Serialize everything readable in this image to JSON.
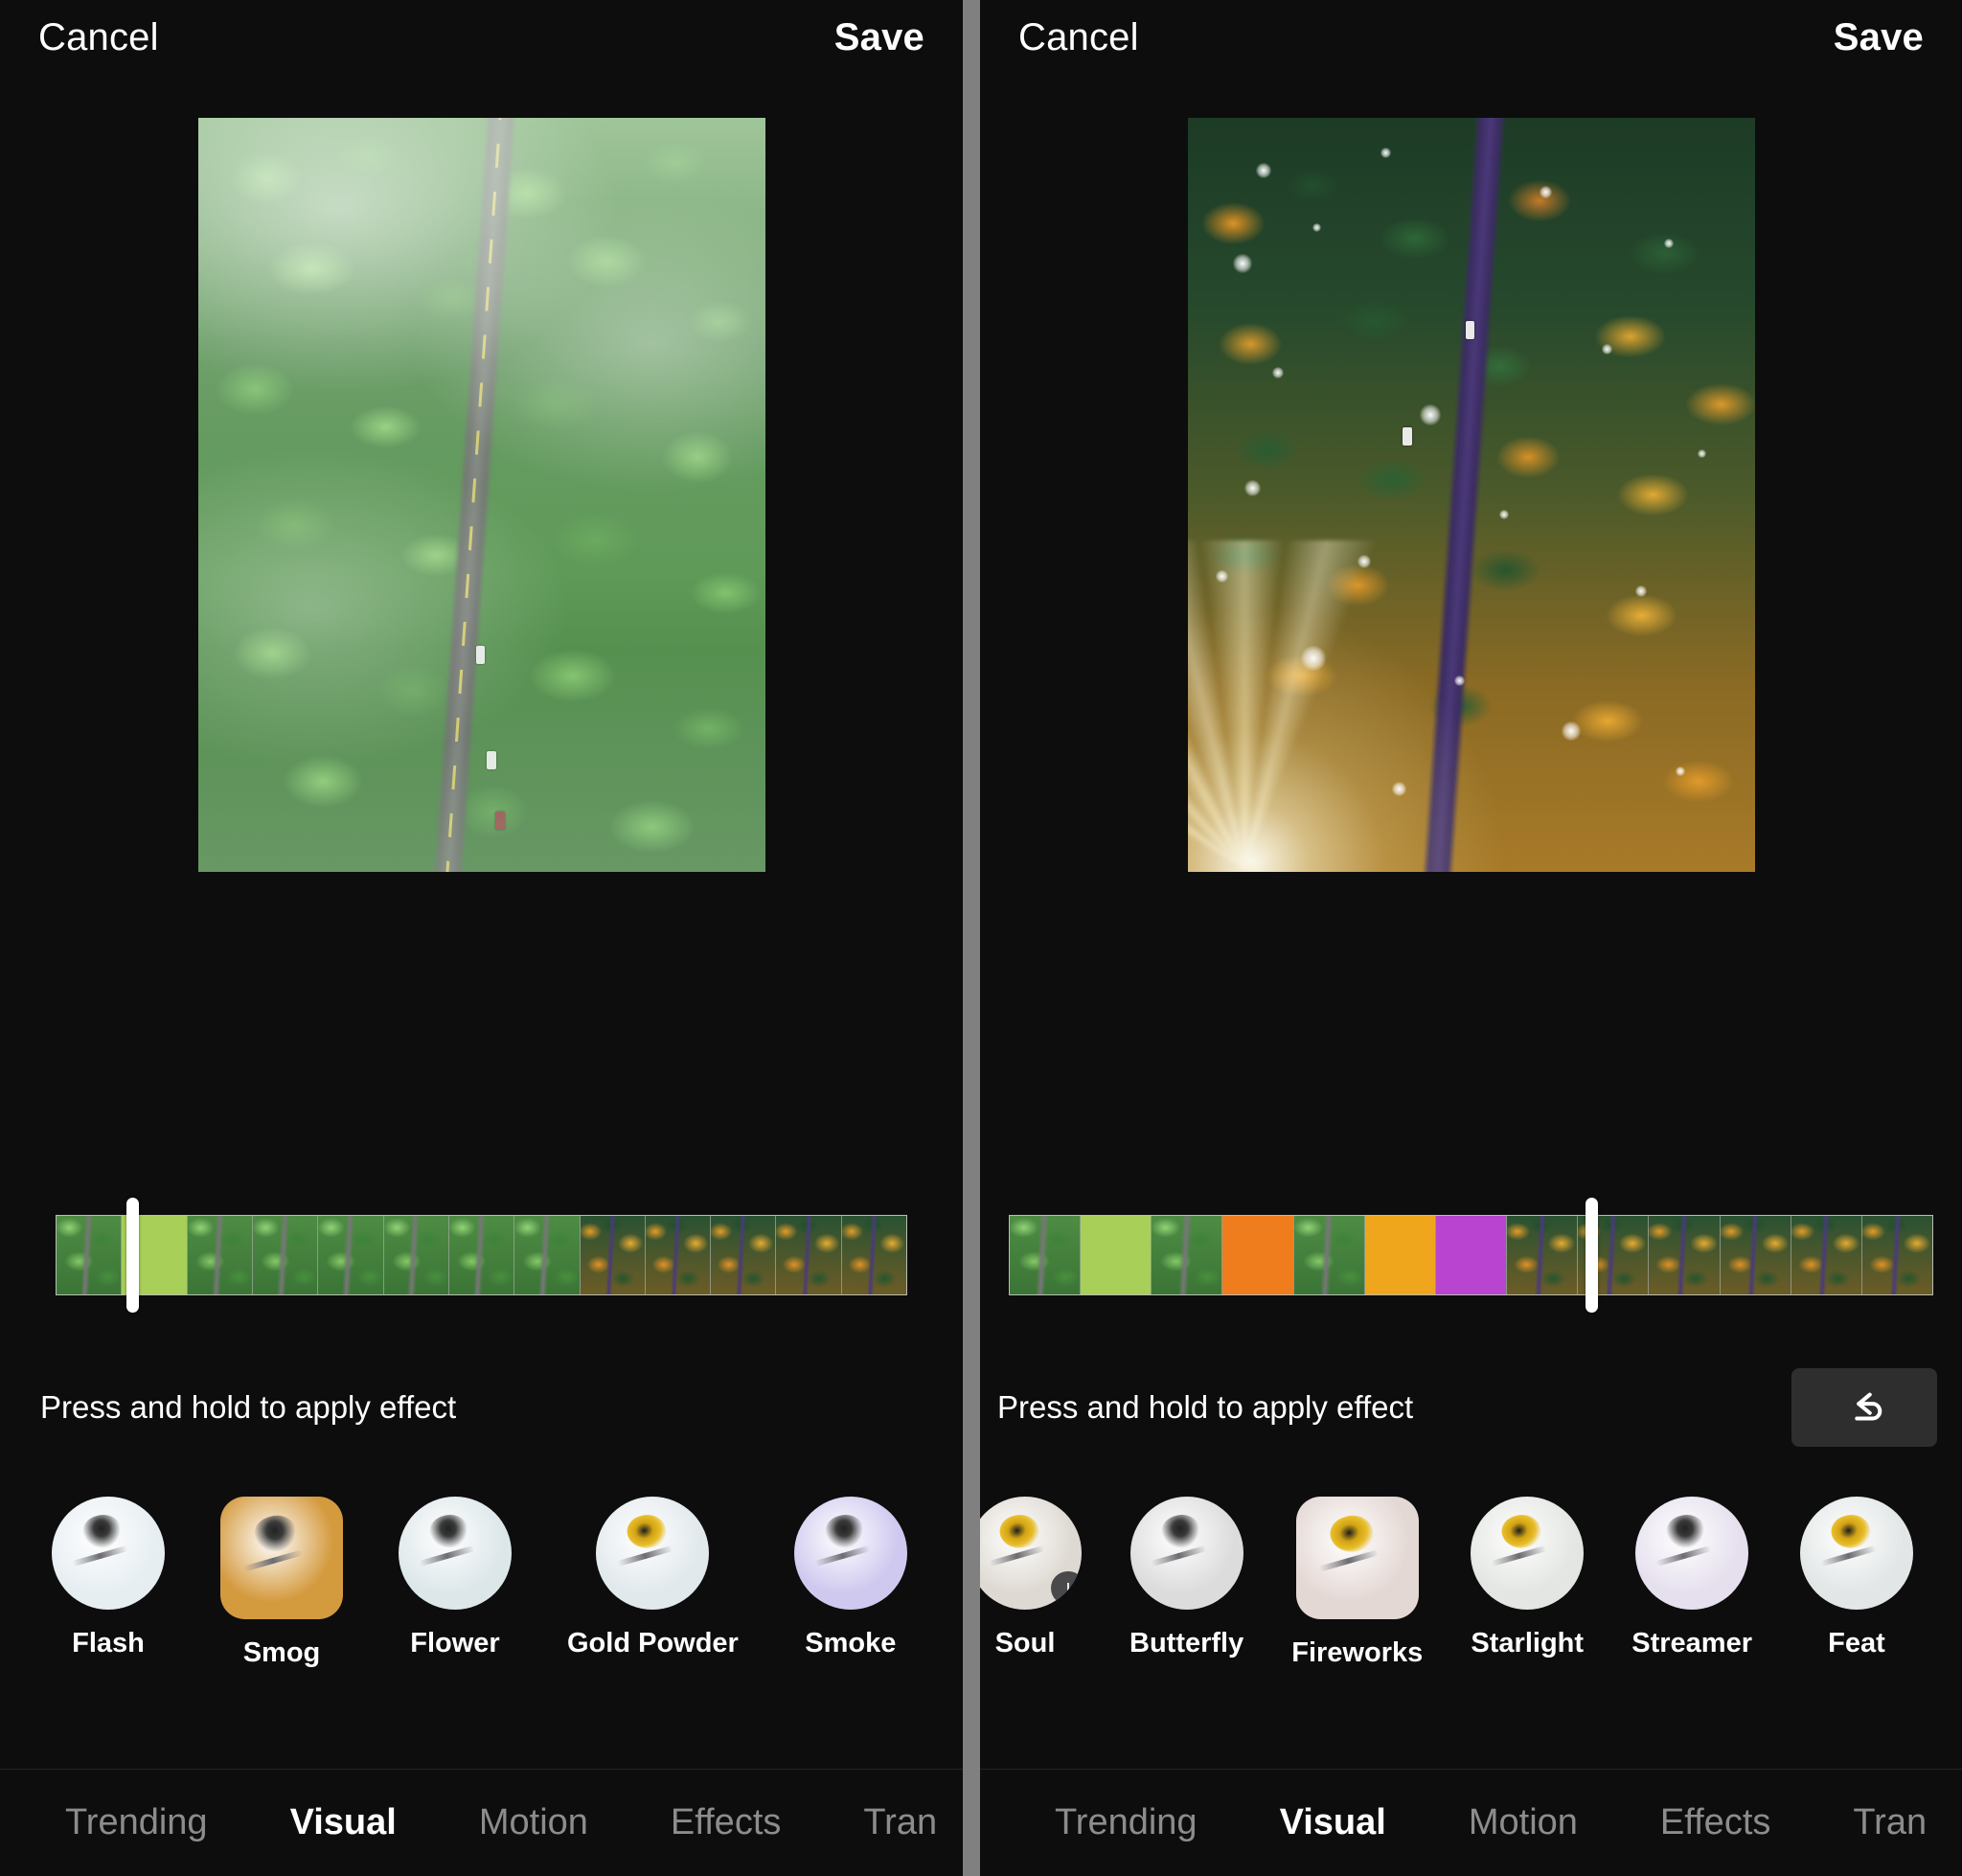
{
  "app": {
    "screen_name": "video-effects-editor",
    "accent_white": "#ffffff",
    "background": "#0d0d0d",
    "divider_color": "#808080"
  },
  "panels": [
    {
      "id": "left",
      "header": {
        "cancel_label": "Cancel",
        "save_label": "Save"
      },
      "hint": {
        "text": "Press and hold to apply effect",
        "undo_visible": false,
        "undo_icon": "undo-icon"
      },
      "timeline": {
        "playhead_percent": 9,
        "frames": [
          {
            "type": "green",
            "overlay": "none"
          },
          {
            "type": "green",
            "overlay": "#a8cf58"
          },
          {
            "type": "green",
            "overlay": "none"
          },
          {
            "type": "green",
            "overlay": "none"
          },
          {
            "type": "green",
            "overlay": "none"
          },
          {
            "type": "green",
            "overlay": "none"
          },
          {
            "type": "green",
            "overlay": "none"
          },
          {
            "type": "green",
            "overlay": "none"
          },
          {
            "type": "autumn",
            "overlay": "none"
          },
          {
            "type": "autumn",
            "overlay": "none"
          },
          {
            "type": "autumn",
            "overlay": "none"
          },
          {
            "type": "autumn",
            "overlay": "none"
          },
          {
            "type": "autumn",
            "overlay": "none"
          }
        ]
      },
      "effects": [
        {
          "label": "Flash",
          "thumb": "flash-thumb",
          "shape": "circle",
          "tint": "#e7eef2",
          "selected": false,
          "badge": false
        },
        {
          "label": "Smog",
          "thumb": "smog-thumb",
          "shape": "squircle",
          "tint": "#d49a3e",
          "selected": true,
          "badge": false
        },
        {
          "label": "Flower",
          "thumb": "flower-thumb",
          "shape": "circle",
          "tint": "#dde7ea",
          "selected": false,
          "badge": false
        },
        {
          "label": "Gold Powder",
          "thumb": "gold-powder-thumb",
          "shape": "circle",
          "tint": "#e2e9ec",
          "selected": false,
          "badge": false
        },
        {
          "label": "Smoke",
          "thumb": "smoke-thumb",
          "shape": "circle",
          "tint": "#cfc9ef",
          "selected": false,
          "badge": false
        }
      ],
      "tabs": [
        {
          "label": "Trending",
          "active": false
        },
        {
          "label": "Visual",
          "active": true
        },
        {
          "label": "Motion",
          "active": false
        },
        {
          "label": "Effects",
          "active": false
        },
        {
          "label": "Tran",
          "active": false
        }
      ]
    },
    {
      "id": "right",
      "header": {
        "cancel_label": "Cancel",
        "save_label": "Save"
      },
      "hint": {
        "text": "Press and hold to apply effect",
        "undo_visible": true,
        "undo_icon": "undo-icon"
      },
      "timeline": {
        "playhead_percent": 63,
        "frames": [
          {
            "type": "green",
            "overlay": "none"
          },
          {
            "type": "green",
            "overlay": "#a8cf58"
          },
          {
            "type": "green",
            "overlay": "none"
          },
          {
            "type": "green",
            "overlay": "#ef7d1e"
          },
          {
            "type": "green",
            "overlay": "none"
          },
          {
            "type": "green",
            "overlay": "#efa61c"
          },
          {
            "type": "green",
            "overlay": "#b844cf"
          },
          {
            "type": "autumn",
            "overlay": "none"
          },
          {
            "type": "autumn",
            "overlay": "none"
          },
          {
            "type": "autumn",
            "overlay": "none"
          },
          {
            "type": "autumn",
            "overlay": "none"
          },
          {
            "type": "autumn",
            "overlay": "none"
          },
          {
            "type": "autumn",
            "overlay": "none"
          }
        ]
      },
      "effects": [
        {
          "label": "Soul",
          "thumb": "soul-thumb",
          "shape": "circle",
          "tint": "#ded9d2",
          "selected": false,
          "badge": true
        },
        {
          "label": "Butterfly",
          "thumb": "butterfly-thumb",
          "shape": "circle",
          "tint": "#dcdcdc",
          "selected": false,
          "badge": false
        },
        {
          "label": "Fireworks",
          "thumb": "fireworks-thumb",
          "shape": "squircle",
          "tint": "#e4d8d4",
          "selected": true,
          "badge": false
        },
        {
          "label": "Starlight",
          "thumb": "starlight-thumb",
          "shape": "circle",
          "tint": "#e3e6e2",
          "selected": false,
          "badge": false
        },
        {
          "label": "Streamer",
          "thumb": "streamer-thumb",
          "shape": "circle",
          "tint": "#e6e0ee",
          "selected": false,
          "badge": false
        },
        {
          "label": "Feat",
          "thumb": "feather-thumb",
          "shape": "circle",
          "tint": "#e2e6e6",
          "selected": false,
          "badge": false
        }
      ],
      "tabs": [
        {
          "label": "Trending",
          "active": false
        },
        {
          "label": "Visual",
          "active": true
        },
        {
          "label": "Motion",
          "active": false
        },
        {
          "label": "Effects",
          "active": false
        },
        {
          "label": "Tran",
          "active": false
        }
      ]
    }
  ]
}
